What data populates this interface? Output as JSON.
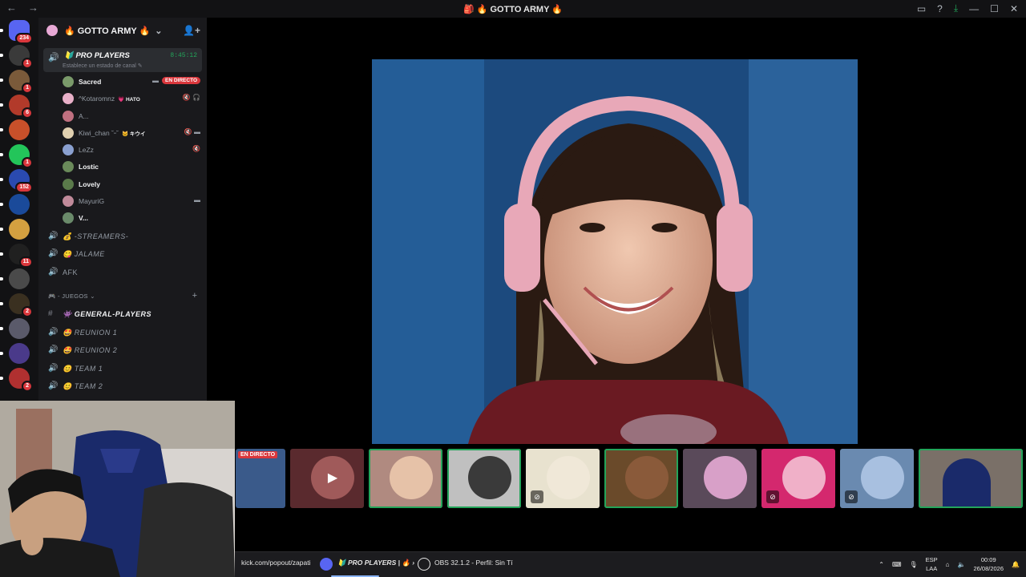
{
  "window": {
    "title": "🎒 🔥 GOTTO ARMY 🔥"
  },
  "servers": [
    {
      "badge": "234",
      "color": "#5865f2"
    },
    {
      "badge": "1",
      "color": "#3a3a3a"
    },
    {
      "badge": "1",
      "color": "#7a5a3a"
    },
    {
      "badge": "6",
      "color": "#b23a2a"
    },
    {
      "badge": "",
      "color": "#c8502a"
    },
    {
      "badge": "1",
      "color": "#23c55a"
    },
    {
      "badge": "152",
      "color": "#2a4ab0"
    },
    {
      "badge": "",
      "color": "#1a4a9a"
    },
    {
      "badge": "",
      "color": "#d4a040"
    },
    {
      "badge": "11",
      "color": "#202020"
    },
    {
      "badge": "",
      "color": "#4a4a4a"
    },
    {
      "badge": "2",
      "color": "#3a3020"
    },
    {
      "badge": "",
      "color": "#5a5a6a"
    },
    {
      "badge": "",
      "color": "#4a3a8a"
    },
    {
      "badge": "2",
      "color": "#b03030"
    }
  ],
  "guild": {
    "name": "🔥 GOTTO ARMY 🔥"
  },
  "voice_channel": {
    "name": "🔰 PRO PLAYERS",
    "timer": "8:45:12",
    "status": "Establece un estado de canal ✎"
  },
  "members": [
    {
      "name": "Sacred",
      "style": "bold",
      "color": "#7a9a6a",
      "live": "EN DIRECTO",
      "icons": "▬",
      "tag": ""
    },
    {
      "name": "^Kotaromnz",
      "style": "dim",
      "color": "#e8b0c8",
      "live": "",
      "icons": "🔇 🎧",
      "tag": "💗 HATO"
    },
    {
      "name": "A...",
      "style": "dim",
      "color": "#c07080",
      "live": "",
      "icons": "",
      "tag": ""
    },
    {
      "name": "Kiwi_chan ˘ᵕ˘",
      "style": "dim",
      "color": "#e0d0b0",
      "live": "",
      "icons": "🔇 ▬",
      "tag": "🐱 キウイ"
    },
    {
      "name": "LeZz",
      "style": "dim",
      "color": "#8aa0d0",
      "live": "",
      "icons": "🔇",
      "tag": ""
    },
    {
      "name": "Lostic",
      "style": "bold",
      "color": "#6a8a5a",
      "live": "",
      "icons": "",
      "tag": ""
    },
    {
      "name": "Lovely",
      "style": "bold",
      "color": "#5a7a4a",
      "live": "",
      "icons": "",
      "tag": ""
    },
    {
      "name": "MayuriG",
      "style": "dim",
      "color": "#c08a9a",
      "live": "",
      "icons": "▬",
      "tag": ""
    },
    {
      "name": "V...",
      "style": "bold",
      "color": "#6a8a6a",
      "live": "",
      "icons": "",
      "tag": ""
    }
  ],
  "channels_top": [
    {
      "icon": "🔊",
      "name": "💰 -STREAMERS-",
      "style": "italic"
    },
    {
      "icon": "🔊",
      "name": "😋 JALAME",
      "style": "italic"
    },
    {
      "icon": "🔊",
      "name": "AFK",
      "style": "plain"
    }
  ],
  "category": {
    "label": "🎮 - JUEGOS ⌄",
    "plus": "+"
  },
  "channels_games": [
    {
      "icon": "#",
      "name": "👾 GENERAL-PLAYERS",
      "style": "active"
    },
    {
      "icon": "🔊",
      "name": "🤩 REUNION 1",
      "style": "italic"
    },
    {
      "icon": "🔊",
      "name": "🤩 REUNION 2",
      "style": "italic"
    },
    {
      "icon": "🔊",
      "name": "😊 TEAM 1",
      "style": "italic"
    },
    {
      "icon": "🔊",
      "name": "😊 TEAM 2",
      "style": "italic"
    }
  ],
  "tiles": [
    {
      "kind": "live",
      "label": "EN DIRECTO",
      "bg": "#3a5a8a",
      "speaking": false,
      "muted": false
    },
    {
      "kind": "camera",
      "bg": "#5a2a2e",
      "circle": "#a05a5a",
      "speaking": false,
      "muted": false
    },
    {
      "kind": "avatar",
      "bg": "#b08a80",
      "circle": "#e6c2a8",
      "speaking": true,
      "muted": false
    },
    {
      "kind": "avatar",
      "bg": "#c0c0c0",
      "circle": "#3a3a3a",
      "speaking": true,
      "muted": false
    },
    {
      "kind": "avatar",
      "bg": "#e8e2cf",
      "circle": "#f0e8d8",
      "speaking": false,
      "muted": true
    },
    {
      "kind": "avatar",
      "bg": "#6a4a2a",
      "circle": "#8a5a3a",
      "speaking": true,
      "muted": false
    },
    {
      "kind": "avatar",
      "bg": "#5a4a5a",
      "circle": "#d8a0c8",
      "speaking": false,
      "muted": false
    },
    {
      "kind": "avatar",
      "bg": "#d4286e",
      "circle": "#f0b0c8",
      "speaking": false,
      "muted": true
    },
    {
      "kind": "avatar",
      "bg": "#6a8ab0",
      "circle": "#a8c0e0",
      "speaking": false,
      "muted": true
    },
    {
      "kind": "webcam",
      "bg": "#7a7068",
      "speaking": true,
      "muted": false
    }
  ],
  "taskbar": {
    "kick": "kick.com/popout/zapati",
    "discord": "🔰 PRO PLAYERS | 🔥 ›",
    "obs": "OBS 32.1.2 - Perfil: Sin Tí",
    "lang_top": "ESP",
    "lang_bottom": "LAA",
    "time": "00:09",
    "date": "26/08/2026"
  }
}
